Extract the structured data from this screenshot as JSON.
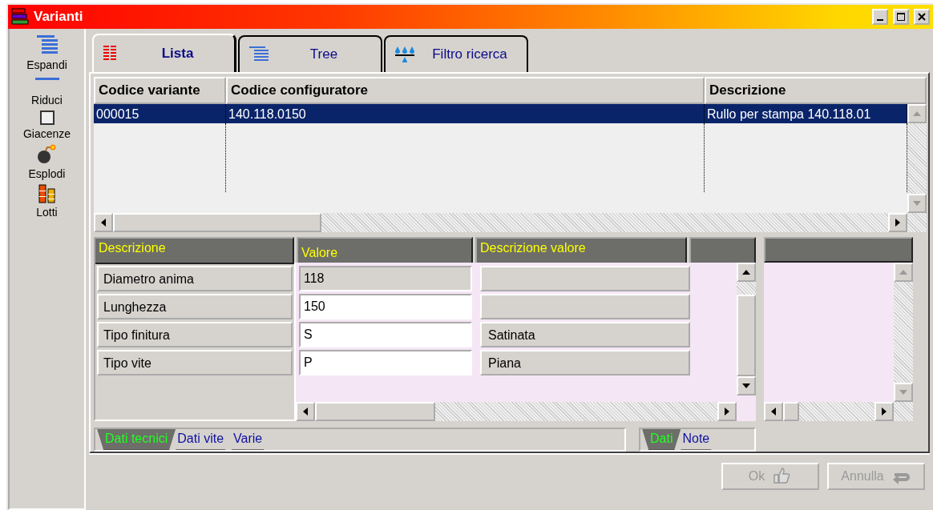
{
  "window": {
    "title": "Varianti"
  },
  "toolbar": [
    {
      "kind": "button",
      "label": "Espandi"
    },
    {
      "kind": "button",
      "label": "Riduci"
    },
    {
      "kind": "checkbox",
      "label": "Giacenze",
      "checked": false
    },
    {
      "kind": "button",
      "label": "Esplodi"
    },
    {
      "kind": "button",
      "label": "Lotti"
    }
  ],
  "tabs": [
    {
      "label": "Lista",
      "selected": true
    },
    {
      "label": "Tree",
      "selected": false
    },
    {
      "label": "Filtro ricerca",
      "selected": false
    }
  ],
  "variants_table": {
    "columns": [
      "Codice variante",
      "Codice configuratore",
      "Descrizione"
    ],
    "rows": [
      {
        "cells": [
          "000015",
          "140.118.0150",
          "Rullo per stampa 140.118.01"
        ],
        "selected": true
      }
    ]
  },
  "properties": {
    "columns": [
      "Descrizione",
      "Valore",
      "Descrizione valore"
    ],
    "rows": [
      {
        "name": "Diametro anima",
        "value": "118",
        "disabled": true
      },
      {
        "name": "Lunghezza",
        "value": "150",
        "disabled": false
      },
      {
        "name": "Tipo finitura",
        "value": "S",
        "disabled": false,
        "value_description": "Satinata"
      },
      {
        "name": "Tipo vite",
        "value": "P",
        "disabled": false,
        "value_description": "Piana"
      }
    ]
  },
  "section_tabs": [
    {
      "label": "Dati tecnici",
      "selected": true
    },
    {
      "label": "Dati vite",
      "selected": false
    },
    {
      "label": "Varie",
      "selected": false
    }
  ],
  "side_tabs": [
    {
      "label": "Dati",
      "selected": true
    },
    {
      "label": "Note",
      "selected": false
    }
  ],
  "buttons": [
    {
      "label": "Ok",
      "disabled": true
    },
    {
      "label": "Annulla",
      "disabled": true
    }
  ]
}
